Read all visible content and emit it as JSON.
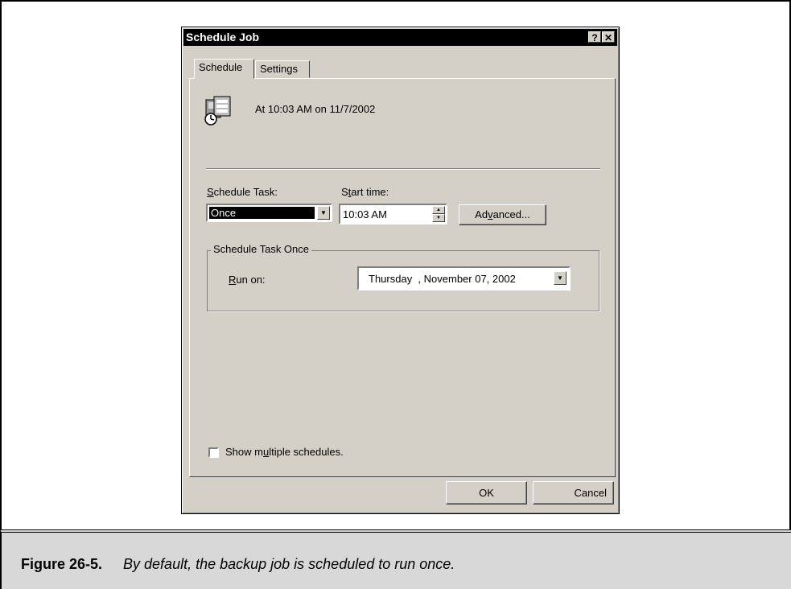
{
  "dialog": {
    "title": "Schedule Job",
    "help_label": "?",
    "close_label": "✕"
  },
  "tabs": [
    {
      "label": "Schedule",
      "active": true
    },
    {
      "label": "Settings",
      "active": false
    }
  ],
  "summary": {
    "icon": "scheduled-task-icon",
    "text": "At 10:03 AM on 11/7/2002"
  },
  "schedule_task": {
    "label_pre": "",
    "label_ul": "S",
    "label_post": "chedule Task:",
    "selected": "Once"
  },
  "start_time": {
    "label_pre": "S",
    "label_ul": "t",
    "label_post": "art time:",
    "value": "10:03 AM"
  },
  "advanced_button": {
    "label_pre": "Ad",
    "label_ul": "v",
    "label_post": "anced..."
  },
  "group": {
    "legend": "Schedule Task Once",
    "run_on_ul": "R",
    "run_on_post": "un on:",
    "date_value": "Thursday  , November 07, 2002"
  },
  "show_multiple": {
    "label_pre": "Show m",
    "label_ul": "u",
    "label_post": "ltiple schedules.",
    "checked": false
  },
  "footer": {
    "ok_label": "OK",
    "cancel_label": "Cancel"
  },
  "caption": {
    "figure": "Figure 26-5.",
    "text": "By default, the backup job is scheduled to run once."
  },
  "colors": {
    "dialog_bg": "#d4d0c8",
    "titlebar_bg": "#000000",
    "caption_bg": "#d8d8d8"
  }
}
